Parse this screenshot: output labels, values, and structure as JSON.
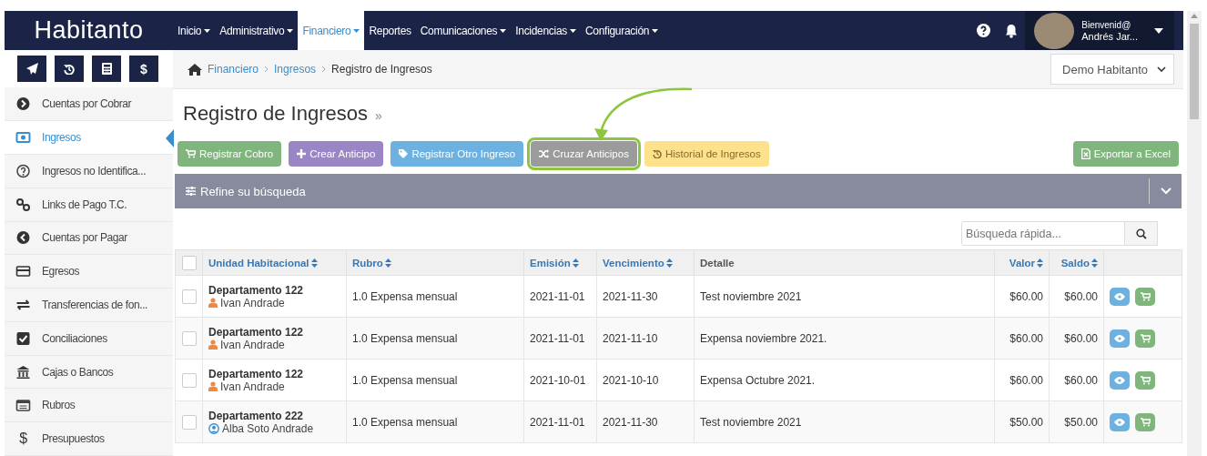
{
  "brand": "Habitanto",
  "nav": [
    {
      "label": "Inicio",
      "dropdown": true,
      "selected": false
    },
    {
      "label": "Administrativo",
      "dropdown": true,
      "selected": false
    },
    {
      "label": "Financiero",
      "dropdown": true,
      "selected": true
    },
    {
      "label": "Reportes",
      "dropdown": false,
      "selected": false
    },
    {
      "label": "Comunicaciones",
      "dropdown": true,
      "selected": false
    },
    {
      "label": "Incidencias",
      "dropdown": true,
      "selected": false
    },
    {
      "label": "Configuración",
      "dropdown": true,
      "selected": false
    }
  ],
  "user": {
    "greeting": "Bienvenid@",
    "name": "Andrés Jar..."
  },
  "quick_action_glyph": "$",
  "sidebar": [
    {
      "label": "Cuentas por Cobrar",
      "selected": false
    },
    {
      "label": "Ingresos",
      "selected": true
    },
    {
      "label": "Ingresos no Identifica...",
      "selected": false
    },
    {
      "label": "Links de Pago T.C.",
      "selected": false
    },
    {
      "label": "Cuentas por Pagar",
      "selected": false
    },
    {
      "label": "Egresos",
      "selected": false
    },
    {
      "label": "Transferencias de fon...",
      "selected": false
    },
    {
      "label": "Conciliaciones",
      "selected": false
    },
    {
      "label": "Cajas o Bancos",
      "selected": false
    },
    {
      "label": "Rubros",
      "selected": false
    },
    {
      "label": "Presupuestos",
      "selected": false,
      "glyph": "$"
    }
  ],
  "breadcrumb": [
    {
      "label": "Financiero",
      "link": true
    },
    {
      "label": "Ingresos",
      "link": true
    },
    {
      "label": "Registro de Ingresos",
      "link": false
    }
  ],
  "community_select": "Demo Habitanto",
  "page_title": "Registro de Ingresos",
  "title_mark": "»",
  "actions": [
    {
      "label": "Registrar Cobro",
      "kind": "cobro",
      "highlighted": false
    },
    {
      "label": "Crear Anticipo",
      "kind": "anticipo",
      "highlighted": false
    },
    {
      "label": "Registrar Otro Ingreso",
      "kind": "otro",
      "highlighted": false
    },
    {
      "label": "Cruzar Anticipos",
      "kind": "cruzar",
      "highlighted": true
    },
    {
      "label": "Historial de Ingresos",
      "kind": "historial",
      "highlighted": false
    }
  ],
  "export_button": "Exportar a Excel",
  "filter_bar": "Refine su búsqueda",
  "search": {
    "placeholder": "Búsqueda rápida..."
  },
  "select_all": {
    "checked": false
  },
  "columns": [
    {
      "label": "Unidad Habitacional",
      "sortable": true
    },
    {
      "label": "Rubro",
      "sortable": true
    },
    {
      "label": "Emisión",
      "sortable": true
    },
    {
      "label": "Vencimiento",
      "sortable": true
    },
    {
      "label": "Detalle",
      "sortable": false
    },
    {
      "label": "Valor",
      "sortable": true
    },
    {
      "label": "Saldo",
      "sortable": true
    }
  ],
  "rows": [
    {
      "checked": false,
      "unit": "Departamento 122",
      "person": "Ivan Andrade",
      "kind": "owner",
      "rubro": "1.0 Expensa mensual",
      "emision": "2021-11-01",
      "vencimiento": "2021-11-30",
      "detalle": "Test noviembre 2021",
      "valor": "$60.00",
      "saldo": "$60.00"
    },
    {
      "checked": false,
      "unit": "Departamento 122",
      "person": "Ivan Andrade",
      "kind": "owner",
      "rubro": "1.0 Expensa mensual",
      "emision": "2021-11-01",
      "vencimiento": "2021-11-10",
      "detalle": "Expensa noviembre 2021.",
      "valor": "$60.00",
      "saldo": "$60.00"
    },
    {
      "checked": false,
      "unit": "Departamento 122",
      "person": "Ivan Andrade",
      "kind": "owner",
      "rubro": "1.0 Expensa mensual",
      "emision": "2021-10-01",
      "vencimiento": "2021-10-10",
      "detalle": "Expensa Octubre 2021.",
      "valor": "$60.00",
      "saldo": "$60.00"
    },
    {
      "checked": false,
      "unit": "Departamento 222",
      "person": "Alba Soto Andrade",
      "kind": "tenant",
      "rubro": "1.0 Expensa mensual",
      "emision": "2021-11-01",
      "vencimiento": "2021-11-30",
      "detalle": "Test noviembre 2021",
      "valor": "$50.00",
      "saldo": "$50.00"
    }
  ]
}
